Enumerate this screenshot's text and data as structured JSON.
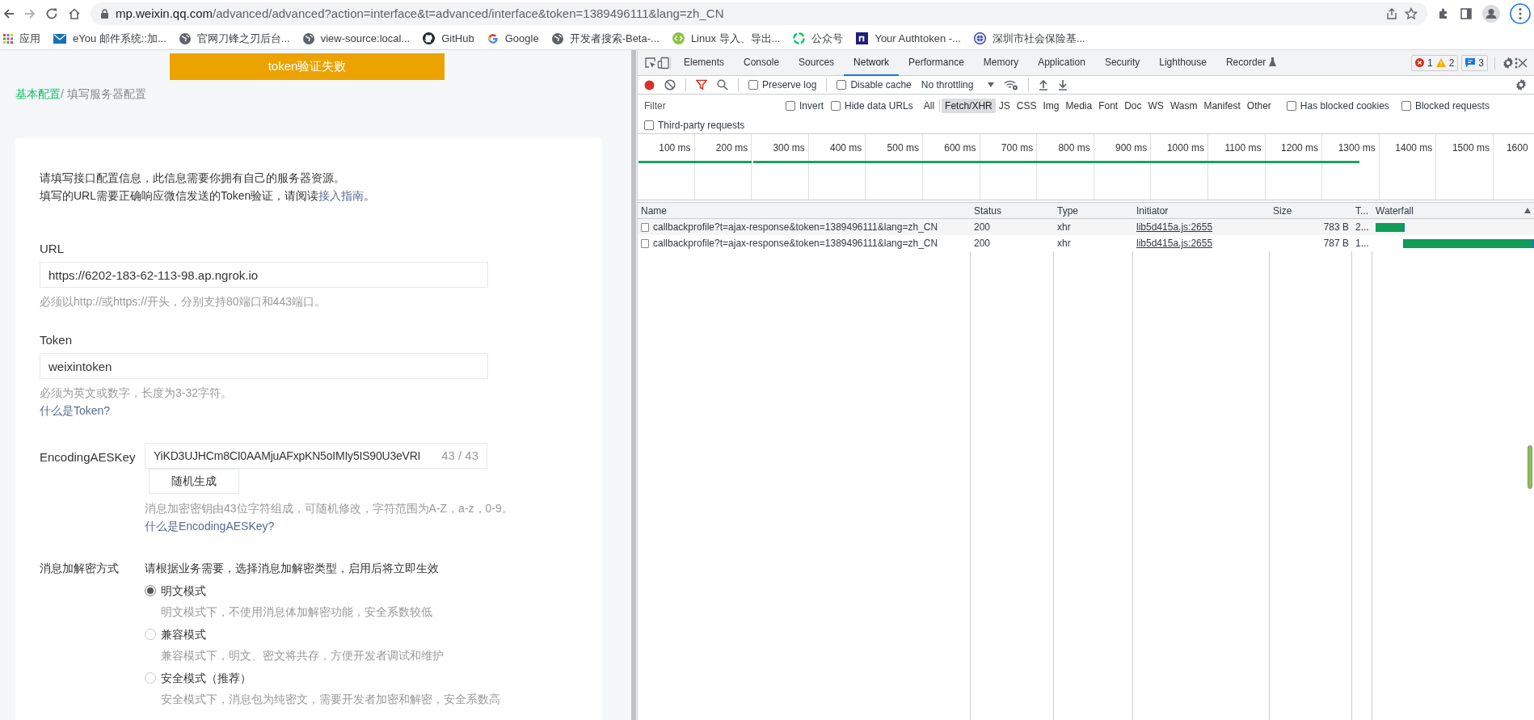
{
  "browser": {
    "url_host": "mp.weixin.qq.com",
    "url_path": "/advanced/advanced?action=interface&t=advanced/interface&token=1389496111&lang=zh_CN",
    "bookmarks": [
      {
        "kind": "apps",
        "label": "应用"
      },
      {
        "kind": "mail",
        "label": "eYou 邮件系统::加..."
      },
      {
        "kind": "globe",
        "label": "官网刀锋之刃后台..."
      },
      {
        "kind": "globe",
        "label": "view-source:local..."
      },
      {
        "kind": "github",
        "label": "GitHub"
      },
      {
        "kind": "google",
        "label": "Google"
      },
      {
        "kind": "globe",
        "label": "开发者搜索-Beta-..."
      },
      {
        "kind": "code",
        "label": "Linux 导入、导出..."
      },
      {
        "kind": "wechat",
        "label": "公众号"
      },
      {
        "kind": "n",
        "label": "Your Authtoken -..."
      },
      {
        "kind": "emblem",
        "label": "深圳市社会保险基..."
      }
    ]
  },
  "page": {
    "toast": "token验证失败",
    "breadcrumb": {
      "link": "基本配置",
      "current": "/ 填写服务器配置"
    },
    "intro": {
      "line_1": "请填写接口配置信息，此信息需要你拥有自己的服务器资源。",
      "line_2": "填写的URL需要正确响应微信发送的Token验证，请阅读",
      "link": "接入指南",
      "line_2_end": "。"
    },
    "url": {
      "label": "URL",
      "value": "https://6202-183-62-113-98.ap.ngrok.io",
      "hint": "必须以http://或https://开头，分别支持80端口和443端口。"
    },
    "token": {
      "label": "Token",
      "value": "weixintoken",
      "hint": "必须为英文或数字，长度为3-32字符。",
      "link": "什么是Token?"
    },
    "aes_key": {
      "label": "EncodingAESKey",
      "value": "YiKD3UJHCm8CI0AAMjuAFxpKN5oIMIy5IS90U3eVRI",
      "counter": "43",
      "counter_sep": "/",
      "counter_max": "43",
      "button": "随机生成",
      "hint": "消息加密密钥由43位字符组成，可随机修改，字符范围为A-Z，a-z，0-9。",
      "link": "什么是EncodingAESKey?"
    },
    "encryption": {
      "label": "消息加解密方式",
      "description": "请根据业务需要，选择消息加解密类型，启用后将立即生效",
      "options": [
        {
          "label": "明文模式",
          "selected": true,
          "description": "明文模式下，不使用消息体加解密功能，安全系数较低"
        },
        {
          "label": "兼容模式",
          "selected": false,
          "description": "兼容模式下，明文、密文将共存，方便开发者调试和维护"
        },
        {
          "label": "安全模式（推荐）",
          "selected": false,
          "description": "安全模式下，消息包为纯密文，需要开发者加密和解密，安全系数高"
        }
      ]
    }
  },
  "devtools": {
    "tabs": [
      {
        "label": "Elements",
        "selected": false
      },
      {
        "label": "Console",
        "selected": false
      },
      {
        "label": "Sources",
        "selected": false
      },
      {
        "label": "Network",
        "selected": true
      },
      {
        "label": "Performance",
        "selected": false
      },
      {
        "label": "Memory",
        "selected": false
      },
      {
        "label": "Application",
        "selected": false
      },
      {
        "label": "Security",
        "selected": false
      },
      {
        "label": "Lighthouse",
        "selected": false
      },
      {
        "label": "Recorder",
        "selected": false
      }
    ],
    "errors": "1",
    "warnings": "2",
    "messages": "3",
    "toolbar": {
      "preserve_log": {
        "label": "Preserve log",
        "checked": false
      },
      "disable_cache": {
        "label": "Disable cache",
        "checked": false
      },
      "throttling": "No throttling"
    },
    "filter": {
      "placeholder": "Filter",
      "checkboxes": [
        {
          "label": "Invert",
          "checked": false
        },
        {
          "label": "Hide data URLs",
          "checked": false
        }
      ],
      "types": [
        {
          "label": "All",
          "selected": false
        },
        {
          "label": "Fetch/XHR",
          "selected": true
        },
        {
          "label": "JS",
          "selected": false
        },
        {
          "label": "CSS",
          "selected": false
        },
        {
          "label": "Img",
          "selected": false
        },
        {
          "label": "Media",
          "selected": false
        },
        {
          "label": "Font",
          "selected": false
        },
        {
          "label": "Doc",
          "selected": false
        },
        {
          "label": "WS",
          "selected": false
        },
        {
          "label": "Wasm",
          "selected": false
        },
        {
          "label": "Manifest",
          "selected": false
        },
        {
          "label": "Other",
          "selected": false
        }
      ],
      "extra": [
        {
          "label": "Has blocked cookies",
          "checked": false
        },
        {
          "label": "Blocked requests",
          "checked": false
        }
      ],
      "third_party": {
        "label": "Third-party requests",
        "checked": false
      }
    },
    "timeline_ticks": [
      "100 ms",
      "200 ms",
      "300 ms",
      "400 ms",
      "500 ms",
      "600 ms",
      "700 ms",
      "800 ms",
      "900 ms",
      "1000 ms",
      "1100 ms",
      "1200 ms",
      "1300 ms",
      "1400 ms",
      "1500 ms",
      "1600"
    ],
    "columns": [
      "Name",
      "Status",
      "Type",
      "Initiator",
      "Size",
      "T...",
      "Waterfall"
    ],
    "rows": [
      {
        "name": "callbackprofile?t=ajax-response&token=1389496111&lang=zh_CN",
        "status": "200",
        "type": "xhr",
        "initiator": "lib5d415a.js:2655",
        "size": "783 B",
        "time": "2..."
      },
      {
        "name": "callbackprofile?t=ajax-response&token=1389496111&lang=zh_CN",
        "status": "200",
        "type": "xhr",
        "initiator": "lib5d415a.js:2655",
        "size": "787 B",
        "time": "1..."
      }
    ]
  }
}
